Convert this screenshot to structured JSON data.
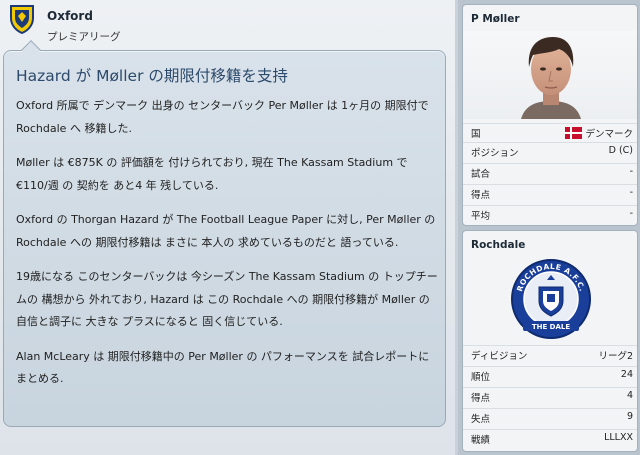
{
  "club": {
    "name": "Oxford",
    "league": "プレミアリーグ"
  },
  "news": {
    "title": "Hazard が Møller の期限付移籍を支持",
    "paragraphs": [
      "Oxford 所属で デンマーク 出身の センターバック Per Møller は 1ヶ月の 期限付で Rochdale へ 移籍した.",
      "Møller は €875K の 評価額を 付けられており, 現在 The Kassam Stadium で €110/週 の 契約を あと4 年 残している.",
      "Oxford の Thorgan Hazard が The Football League Paper に対し, Per Møller の Rochdale への 期限付移籍は まさに 本人の 求めているものだと 語っている.",
      "19歳になる このセンターバックは 今シーズン The Kassam Stadium の トップチームの 構想から 外れており, Hazard は この Rochdale への 期限付移籍が Møller の 自信と調子に 大きな プラスになると 固く信じている.",
      "Alan McLeary は 期限付移籍中の Per Møller の パフォーマンスを 試合レポートに まとめる."
    ]
  },
  "player_panel": {
    "name": "P Møller",
    "rows": [
      {
        "label": "国",
        "value": "デンマーク"
      },
      {
        "label": "ポジション",
        "value": "D (C)"
      },
      {
        "label": "試合",
        "value": "-"
      },
      {
        "label": "得点",
        "value": "-"
      },
      {
        "label": "平均",
        "value": "-"
      }
    ]
  },
  "club_panel": {
    "name": "Rochdale",
    "crest_text_top": "ROCHDALE A.F.C.",
    "crest_text_bottom": "THE DALE",
    "rows": [
      {
        "label": "ディビジョン",
        "value": "リーグ2"
      },
      {
        "label": "順位",
        "value": "24"
      },
      {
        "label": "得点",
        "value": "4"
      },
      {
        "label": "失点",
        "value": "9"
      },
      {
        "label": "戦績",
        "value": "LLLXX"
      }
    ]
  },
  "colors": {
    "title": "#2c4a6c",
    "denmark_red": "#c8102e",
    "rochdale_blue": "#1a3f9a"
  }
}
